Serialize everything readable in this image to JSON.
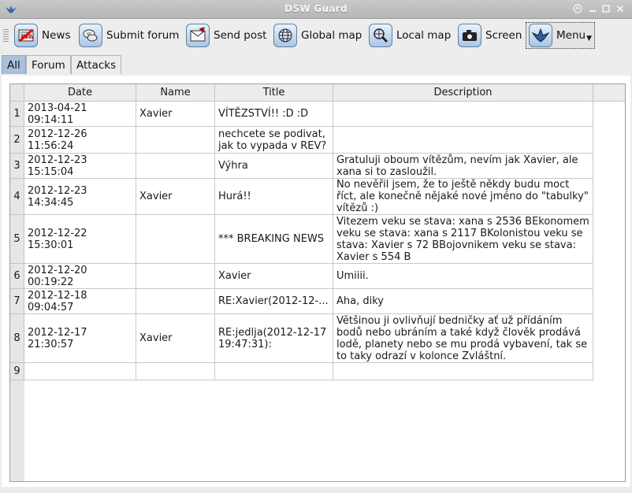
{
  "window": {
    "title": "DSW Guard",
    "controls": [
      "up",
      "minimize",
      "maximize",
      "close"
    ]
  },
  "toolbar": {
    "items": [
      {
        "label": "News",
        "icon": "news-icon"
      },
      {
        "label": "Submit forum",
        "icon": "chat-bubbles-icon"
      },
      {
        "label": "Send post",
        "icon": "envelope-icon"
      },
      {
        "label": "Global map",
        "icon": "globe-icon"
      },
      {
        "label": "Local map",
        "icon": "magnifier-globe-icon"
      },
      {
        "label": "Screen",
        "icon": "camera-icon"
      },
      {
        "label": "Menu",
        "icon": "ship-icon"
      }
    ]
  },
  "tabs": [
    {
      "label": "All",
      "active": true
    },
    {
      "label": "Forum",
      "active": false
    },
    {
      "label": "Attacks",
      "active": false
    }
  ],
  "table": {
    "columns": [
      "Date",
      "Name",
      "Title",
      "Description"
    ],
    "rows": [
      {
        "num": "1",
        "date": "2013-04-21\n09:14:11",
        "name": "Xavier",
        "title": "VÍTĚZSTVÍ!! :D :D",
        "description": ""
      },
      {
        "num": "2",
        "date": "2012-12-26\n11:56:24",
        "name": "",
        "title": "nechcete se podivat,\njak to vypada v REV?",
        "description": ""
      },
      {
        "num": "3",
        "date": "2012-12-23\n15:15:04",
        "name": "",
        "title": "Výhra",
        "description": "Gratuluji oboum vítězům, nevím jak Xavier, ale\nxana si to zasloužil."
      },
      {
        "num": "4",
        "date": "2012-12-23\n14:34:45",
        "name": "Xavier",
        "title": "Hurá!!",
        "description": "No nevěřil jsem, že to ještě někdy budu moct\nříct, ale konečně nějaké nové jméno do \"tabulky\"\nvítězů :)"
      },
      {
        "num": "5",
        "date": "2012-12-22\n15:30:01",
        "name": "",
        "title": "*** BREAKING NEWS",
        "description": "Vitezem veku se stava: xana s 2536 BEkonomem\nveku se stava: xana s 2117 BKolonistou veku se\nstava: Xavier s 72 BBojovnikem veku se stava:\nXavier s 554 B"
      },
      {
        "num": "6",
        "date": "2012-12-20\n00:19:22",
        "name": "",
        "title": "Xavier",
        "description": "Umiiii."
      },
      {
        "num": "7",
        "date": "2012-12-18\n09:04:57",
        "name": "",
        "title": "RE:Xavier(2012-12-...",
        "description": "Aha, diky"
      },
      {
        "num": "8",
        "date": "2012-12-17\n21:30:57",
        "name": "Xavier",
        "title": "RE:jedlja(2012-12-17\n19:47:31):",
        "description": "Většinou ji ovlivňují bedničky ať už přídáním\nbodů nebo ubráním a také když člověk prodává\nlodě, planety nebo se mu prodá vybavení, tak se\nto taky odrazí v kolonce Zvláštní."
      },
      {
        "num": "9",
        "date": "",
        "name": "",
        "title": "",
        "description": ""
      }
    ]
  }
}
